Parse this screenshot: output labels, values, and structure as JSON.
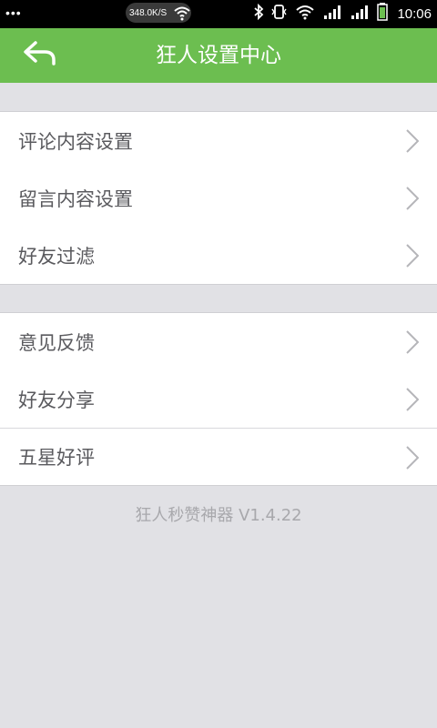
{
  "status_bar": {
    "dots": "•••",
    "net_speed": "348.0K/S",
    "time": "10:06"
  },
  "header": {
    "title": "狂人设置中心"
  },
  "groups": [
    {
      "items": [
        {
          "label": "评论内容设置"
        },
        {
          "label": "留言内容设置"
        },
        {
          "label": "好友过滤"
        }
      ]
    },
    {
      "items": [
        {
          "label": "意见反馈"
        },
        {
          "label": "好友分享"
        },
        {
          "label": "五星好评"
        }
      ]
    }
  ],
  "footer": {
    "version": "狂人秒赞神器 V1.4.22"
  },
  "colors": {
    "header": "#6cbe50",
    "background": "#e1e1e5"
  }
}
